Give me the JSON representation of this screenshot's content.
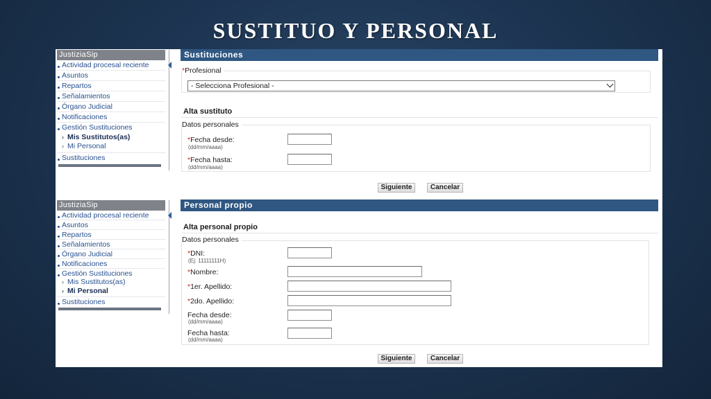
{
  "slide": {
    "title": "SUSTITUO Y PERSONAL"
  },
  "sidebar": {
    "app_name": "JustiziaSip",
    "items": [
      {
        "label": "Actividad procesal reciente"
      },
      {
        "label": "Asuntos"
      },
      {
        "label": "Repartos"
      },
      {
        "label": "Señalamientos"
      },
      {
        "label": "Órgano Judicial"
      },
      {
        "label": "Notificaciones"
      },
      {
        "label": "Gestión Sustituciones"
      },
      {
        "label": "Sustituciones"
      }
    ],
    "subitems": [
      {
        "label": "Mis Sustitutos(as)"
      },
      {
        "label": "Mi Personal"
      }
    ]
  },
  "panel1": {
    "header": "Sustituciones",
    "profesional_legend": "Profesional",
    "profesional_select_value": "- Selecciona Profesional -",
    "section_title": "Alta sustituto",
    "datos_legend": "Datos personales",
    "fields": [
      {
        "label": "Fecha desde:",
        "hint": "(dd/mm/aaaa)",
        "value": ""
      },
      {
        "label": "Fecha hasta:",
        "hint": "(dd/mm/aaaa)",
        "value": ""
      }
    ],
    "next_button": "Siguiente",
    "cancel_button": "Cancelar",
    "active_subitem": "Mis Sustitutos(as)"
  },
  "panel2": {
    "header": "Personal propio",
    "section_title": "Alta personal propio",
    "datos_legend": "Datos personales",
    "fields": [
      {
        "label": "DNI:",
        "hint": "(Ej: 11111111H)",
        "required": true,
        "value": ""
      },
      {
        "label": "Nombre:",
        "required": true,
        "value": ""
      },
      {
        "label": "1er. Apellido:",
        "required": true,
        "value": ""
      },
      {
        "label": "2do. Apellido:",
        "required": true,
        "value": ""
      },
      {
        "label": "Fecha desde:",
        "hint": "(dd/mm/aaaa)",
        "required": false,
        "value": ""
      },
      {
        "label": "Fecha hasta:",
        "hint": "(dd/mm/aaaa)",
        "required": false,
        "value": ""
      }
    ],
    "next_button": "Siguiente",
    "cancel_button": "Cancelar",
    "active_subitem": "Mi Personal"
  },
  "colors": {
    "header_bar": "#2f5782",
    "sidebar_head": "#7f8389",
    "link": "#27508f",
    "required_mark": "#d21f1f",
    "slide_background": "#1d3552"
  }
}
